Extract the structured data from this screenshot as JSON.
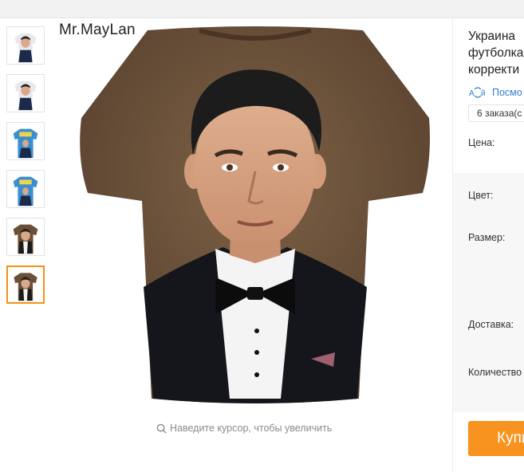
{
  "gallery": {
    "brand": "Mr.MayLan",
    "thumbnails": [
      {
        "variant": "white-shirt",
        "selected": false
      },
      {
        "variant": "white-shirt",
        "selected": false
      },
      {
        "variant": "blue-shirt-printed",
        "selected": false
      },
      {
        "variant": "blue-shirt-printed",
        "selected": false
      },
      {
        "variant": "brown-shirt-portrait",
        "selected": false
      },
      {
        "variant": "brown-shirt-portrait",
        "selected": true
      }
    ],
    "zoom_hint": "Наведите курсор, чтобы увеличить",
    "zoom_icon": "search-icon"
  },
  "product": {
    "title_lines": [
      "Украина",
      "футболка",
      "корректи"
    ],
    "translate_label": "Посмо",
    "translate_icon": "translate-icon",
    "orders_text": "6 заказа(с",
    "price_label": "Цена:",
    "color_label": "Цвет:",
    "size_label": "Размер:",
    "shipping_label": "Доставка:",
    "quantity_label": "Количество",
    "buy_label": "Купи"
  },
  "colors": {
    "accent": "#f7931e",
    "selected_border": "#f29315",
    "link": "#2a7fd4",
    "shirt_brown": "#6b4f36"
  }
}
